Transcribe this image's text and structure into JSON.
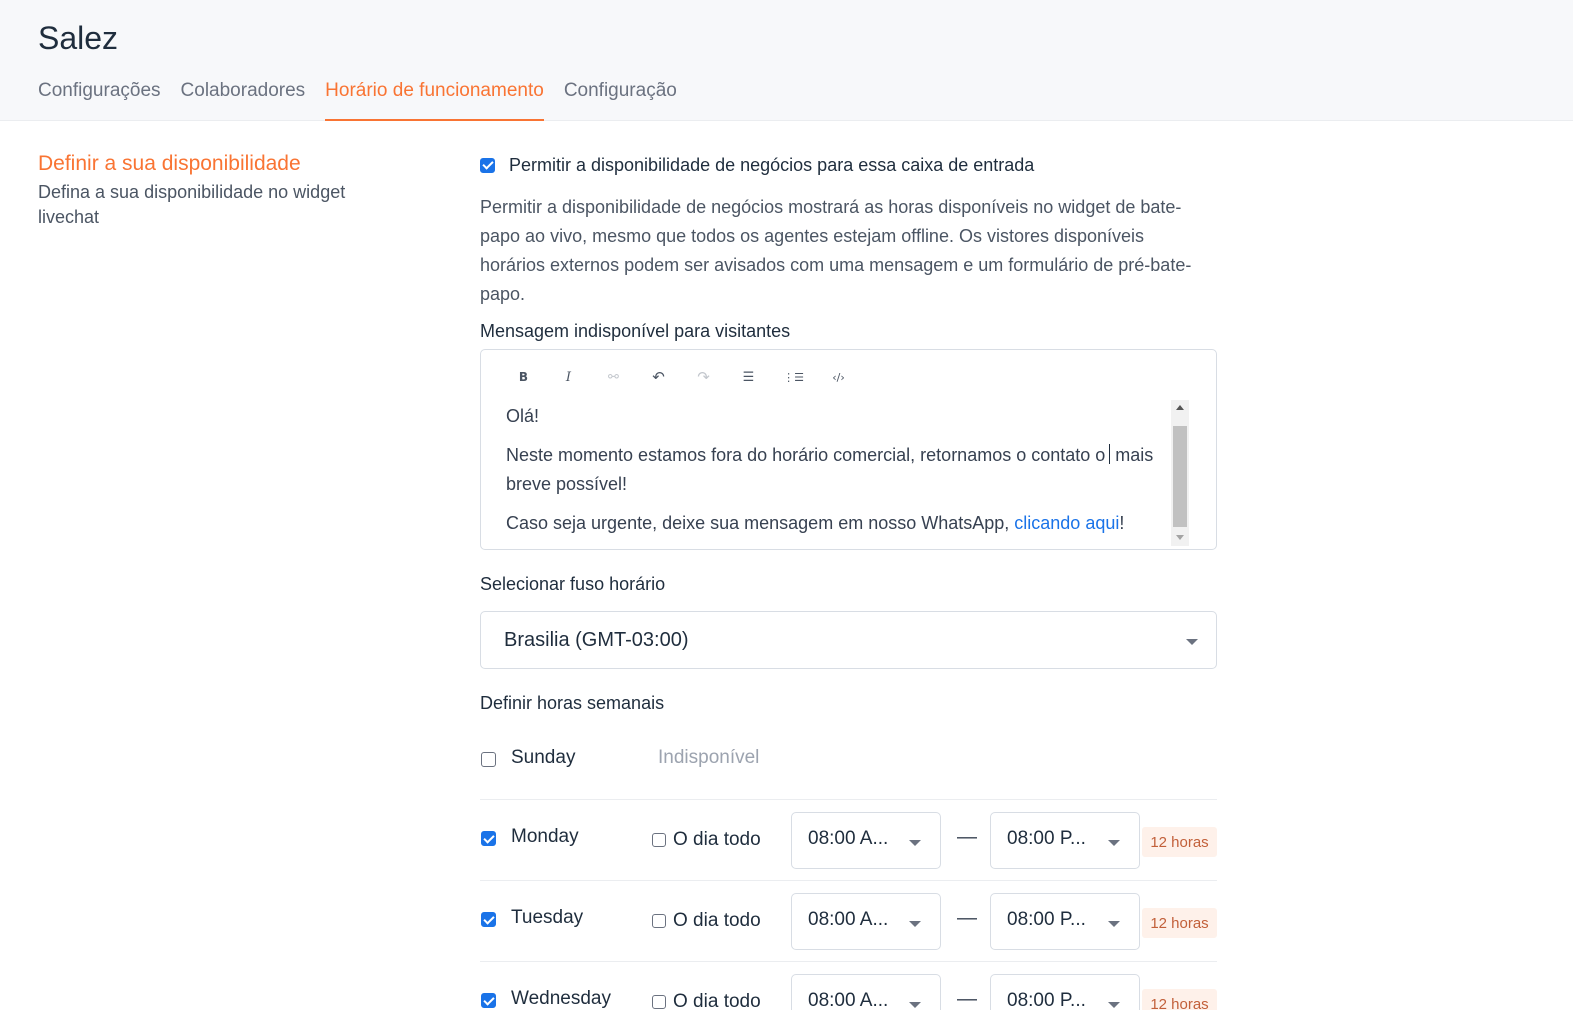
{
  "app": {
    "title": "Salez"
  },
  "tabs": [
    {
      "label": "Configurações",
      "active": false
    },
    {
      "label": "Colaboradores",
      "active": false
    },
    {
      "label": "Horário de funcionamento",
      "active": true
    },
    {
      "label": "Configuração",
      "active": false
    }
  ],
  "section": {
    "title": "Definir a sua disponibilidade",
    "subtitle": "Defina a sua disponibilidade no widget livechat"
  },
  "availability": {
    "enabled": true,
    "label": "Permitir a disponibilidade de negócios para essa caixa de entrada",
    "description": "Permitir a disponibilidade de negócios mostrará as horas disponíveis no widget de bate-papo ao vivo, mesmo que todos os agentes estejam offline. Os vistores disponíveis horários externos podem ser avisados com uma mensagem e um formulário de pré-bate-papo."
  },
  "message_editor": {
    "label": "Mensagem indisponível para visitantes",
    "toolbar": [
      {
        "icon": "bold-icon",
        "glyph": "B",
        "enabled": true
      },
      {
        "icon": "italic-icon",
        "glyph": "I",
        "enabled": true
      },
      {
        "icon": "link-icon",
        "glyph": "⚯",
        "enabled": false
      },
      {
        "icon": "undo-icon",
        "glyph": "↶",
        "enabled": true
      },
      {
        "icon": "redo-icon",
        "glyph": "↷",
        "enabled": false
      },
      {
        "icon": "bullet-list-icon",
        "glyph": "☰",
        "enabled": true
      },
      {
        "icon": "numbered-list-icon",
        "glyph": "⋮☰",
        "enabled": true
      },
      {
        "icon": "code-icon",
        "glyph": "‹/›",
        "enabled": true
      }
    ],
    "greeting": "Olá!",
    "body": "Neste momento estamos fora do horário comercial, retornamos o contato o mais breve possível!",
    "urgent_prefix": "Caso seja urgente, deixe sua mensagem em nosso WhatsApp, ",
    "urgent_link": "clicando aqui",
    "urgent_suffix": "!"
  },
  "timezone": {
    "label": "Selecionar fuso horário",
    "value": "Brasilia (GMT-03:00)"
  },
  "weekly": {
    "label": "Definir horas semanais",
    "unavailable_text": "Indisponível",
    "allday_label": "O dia todo",
    "days": [
      {
        "name": "Sunday",
        "enabled": false
      },
      {
        "name": "Monday",
        "enabled": true,
        "all_day": false,
        "from": "08:00 A...",
        "to": "08:00 P...",
        "hours": "12 horas"
      },
      {
        "name": "Tuesday",
        "enabled": true,
        "all_day": false,
        "from": "08:00 A...",
        "to": "08:00 P...",
        "hours": "12 horas"
      },
      {
        "name": "Wednesday",
        "enabled": true,
        "all_day": false,
        "from": "08:00 A...",
        "to": "08:00 P...",
        "hours": "12 horas"
      }
    ],
    "separator": "—"
  }
}
